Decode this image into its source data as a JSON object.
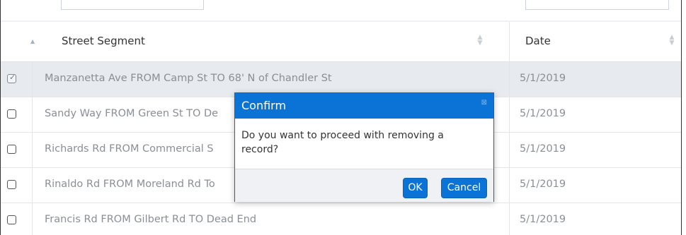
{
  "grid": {
    "headers": {
      "street_segment": "Street Segment",
      "date": "Date"
    },
    "rows": [
      {
        "segment": "Manzanetta Ave FROM Camp St TO 68' N of Chandler St",
        "date": "5/1/2019",
        "checked": true
      },
      {
        "segment": "Sandy Way FROM Green St TO De",
        "date": "5/1/2019",
        "checked": false
      },
      {
        "segment": "Richards Rd FROM Commercial S",
        "date": "5/1/2019",
        "checked": false
      },
      {
        "segment": "Rinaldo Rd FROM Moreland Rd To",
        "date": "5/1/2019",
        "checked": false
      },
      {
        "segment": "Francis Rd FROM Gilbert Rd TO Dead End",
        "date": "5/1/2019",
        "checked": false
      }
    ]
  },
  "dialog": {
    "title": "Confirm",
    "close_icon": "close-icon",
    "message": "Do you want to proceed with removing a record?",
    "ok_label": "OK",
    "cancel_label": "Cancel"
  },
  "colors": {
    "accent": "#0b72d6",
    "selected_row": "#e7eaee"
  }
}
